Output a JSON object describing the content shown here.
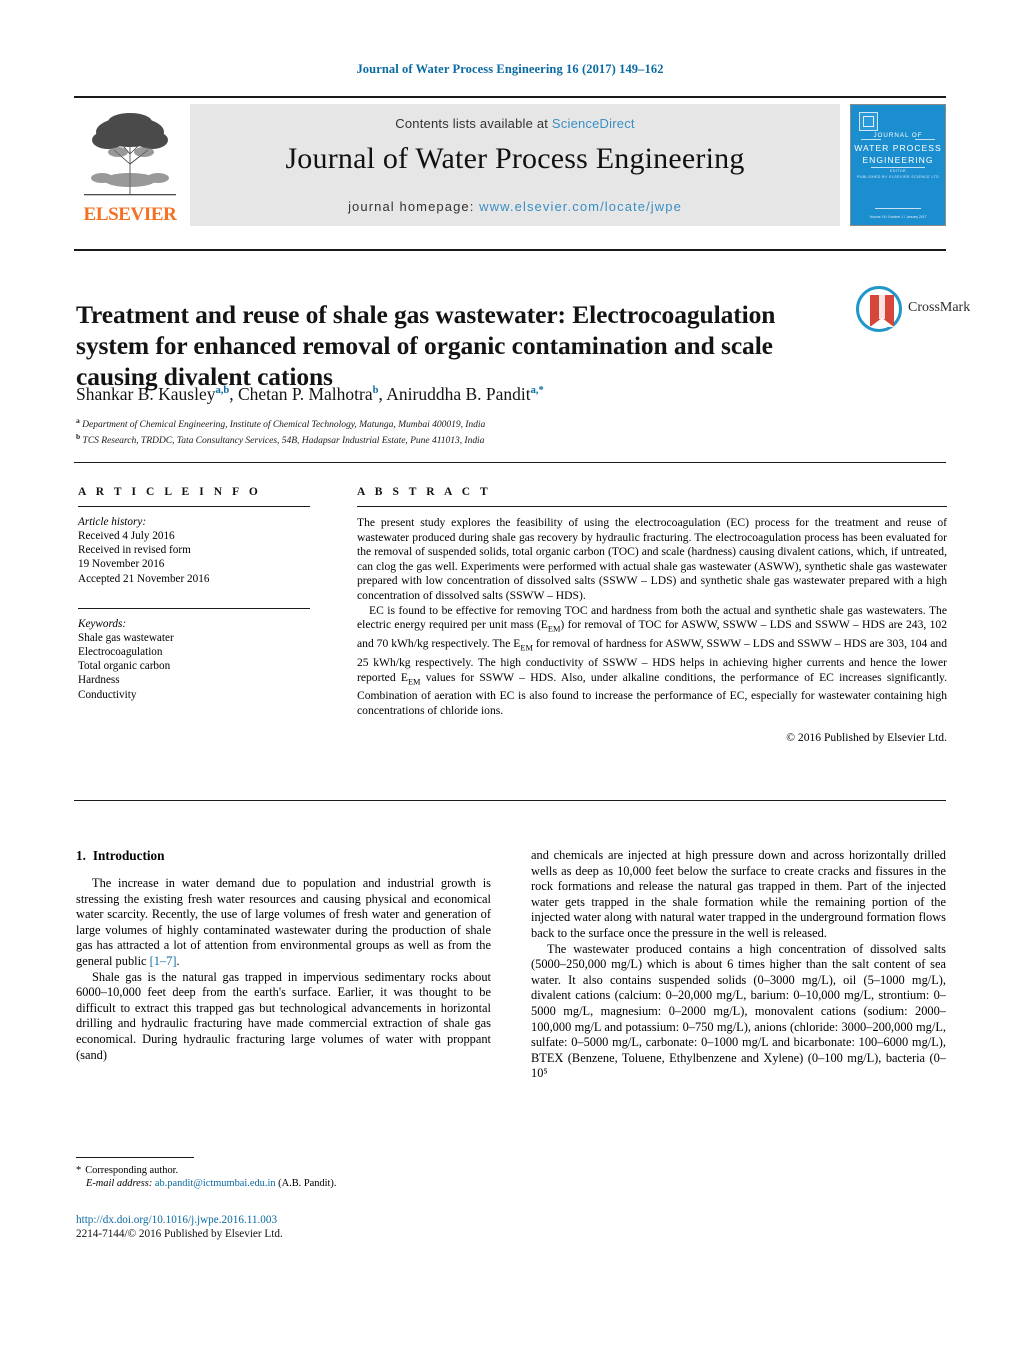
{
  "running_head": "Journal of Water Process Engineering 16 (2017) 149–162",
  "masthead": {
    "publisher_name": "ELSEVIER",
    "contents_prefix": "Contents lists available at ",
    "contents_link": "ScienceDirect",
    "journal_title": "Journal of Water Process Engineering",
    "homepage_prefix": "journal homepage: ",
    "homepage_url": "www.elsevier.com/locate/jwpe",
    "cover": {
      "line1": "JOURNAL OF",
      "line2": "WATER PROCESS",
      "line3": "ENGINEERING",
      "sub1": "EDITOR",
      "sub2": "PUBLISHED BY   ELSEVIER SCIENCE LTD",
      "footer": "Volume 16 / Number 1 / January 2017"
    }
  },
  "crossmark": {
    "label": "CrossMark"
  },
  "article": {
    "title": "Treatment and reuse of shale gas wastewater: Electrocoagulation system for enhanced removal of organic contamination and scale causing divalent cations",
    "authors": [
      {
        "name": "Shankar B. Kausley",
        "marks": "a,b",
        "sep": ", "
      },
      {
        "name": "Chetan P. Malhotra",
        "marks": "b",
        "sep": ", "
      },
      {
        "name": "Aniruddha B. Pandit",
        "marks": "a,*",
        "sep": ""
      }
    ],
    "affiliations": [
      {
        "mark": "a",
        "text": "Department of Chemical Engineering, Institute of Chemical Technology, Matunga, Mumbai 400019, India"
      },
      {
        "mark": "b",
        "text": "TCS Research, TRDDC, Tata Consultancy Services, 54B, Hadapsar Industrial Estate, Pune 411013, India"
      }
    ]
  },
  "article_info": {
    "heading": "A R T I C L E   I N F O",
    "history_title": "Article history:",
    "history_lines": [
      "Received 4 July 2016",
      "Received in revised form",
      "19 November 2016",
      "Accepted 21 November 2016"
    ],
    "keywords_title": "Keywords:",
    "keywords": [
      "Shale gas wastewater",
      "Electrocoagulation",
      "Total organic carbon",
      "Hardness",
      "Conductivity"
    ]
  },
  "abstract": {
    "heading": "A B S T R A C T",
    "paragraphs": [
      "The present study explores the feasibility of using the electrocoagulation (EC) process for the treatment and reuse of wastewater produced during shale gas recovery by hydraulic fracturing. The electrocoagulation process has been evaluated for the removal of suspended solids, total organic carbon (TOC) and scale (hardness) causing divalent cations, which, if untreated, can clog the gas well. Experiments were performed with actual shale gas wastewater (ASWW), synthetic shale gas wastewater prepared with low concentration of dissolved salts (SSWW – LDS) and synthetic shale gas wastewater prepared with a high concentration of dissolved salts (SSWW – HDS).",
      "EC is found to be effective for removing TOC and hardness from both the actual and synthetic shale gas wastewaters. The electric energy required per unit mass (EEM) for removal of TOC for ASWW, SSWW – LDS and SSWW – HDS are 243, 102 and 70 kWh/kg respectively. The EEM for removal of hardness for ASWW, SSWW – LDS and SSWW – HDS are 303, 104 and 25 kWh/kg respectively. The high conductivity of SSWW – HDS helps in achieving higher currents and hence the lower reported EEM values for SSWW – HDS. Also, under alkaline conditions, the performance of EC increases significantly. Combination of aeration with EC is also found to increase the performance of EC, especially for wastewater containing high concentrations of chloride ions."
    ],
    "copyright": "© 2016 Published by Elsevier Ltd."
  },
  "body": {
    "section_number": "1.",
    "section_title": "Introduction",
    "left_paragraphs": [
      "The increase in water demand due to population and industrial growth is stressing the existing fresh water resources and causing physical and economical water scarcity. Recently, the use of large volumes of fresh water and generation of large volumes of highly contaminated wastewater during the production of shale gas has attracted a lot of attention from environmental groups as well as from the general public ",
      "Shale gas is the natural gas trapped in impervious sedimentary rocks about 6000–10,000 feet deep from the earth's surface. Earlier, it was thought to be difficult to extract this trapped gas but technological advancements in horizontal drilling and hydraulic fracturing have made commercial extraction of shale gas economical. During hydraulic fracturing large volumes of water with proppant (sand)"
    ],
    "left_citation": "[1–7]",
    "left_citation_tail": ".",
    "right_paragraphs": [
      "and chemicals are injected at high pressure down and across horizontally drilled wells as deep as 10,000 feet below the surface to create cracks and fissures in the rock formations and release the natural gas trapped in them. Part of the injected water gets trapped in the shale formation while the remaining portion of the injected water along with natural water trapped in the underground formation flows back to the surface once the pressure in the well is released.",
      "The wastewater produced contains a high concentration of dissolved salts (5000–250,000 mg/L) which is about 6 times higher than the salt content of sea water. It also contains suspended solids (0–3000 mg/L), oil (5–1000 mg/L), divalent cations (calcium: 0–20,000 mg/L, barium: 0–10,000 mg/L, strontium: 0–5000 mg/L, magnesium: 0–2000 mg/L), monovalent cations (sodium: 2000–100,000 mg/L and potassium: 0–750 mg/L), anions (chloride: 3000–200,000 mg/L, sulfate: 0–5000 mg/L, carbonate: 0–1000 mg/L and bicarbonate: 100–6000 mg/L), BTEX (Benzene, Toluene, Ethylbenzene and Xylene) (0–100 mg/L), bacteria (0–10⁵"
    ]
  },
  "footnote": {
    "star": "*",
    "corresponding": "Corresponding author.",
    "email_label": "E-mail address:",
    "email": "ab.pandit@ictmumbai.edu.in",
    "email_owner": "(A.B. Pandit)."
  },
  "footer": {
    "doi": "http://dx.doi.org/10.1016/j.jwpe.2016.11.003",
    "issn_line": "2214-7144/© 2016 Published by Elsevier Ltd."
  },
  "colors": {
    "link_blue": "#0b6aa2",
    "sciencedirect_blue": "#3a8fc4",
    "elsevier_orange": "#F37021",
    "cover_blue": "#1b8ed0"
  }
}
